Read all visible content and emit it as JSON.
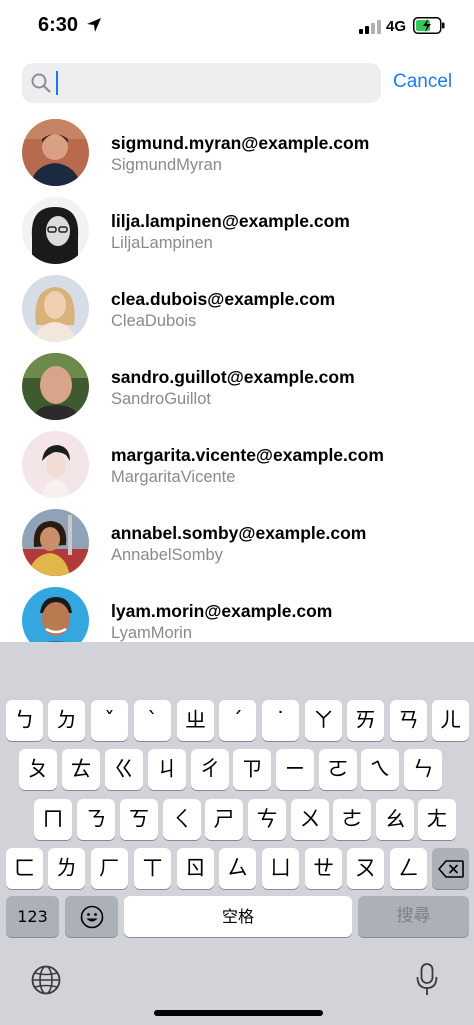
{
  "status_bar": {
    "time": "6:30",
    "network": "4G",
    "icons": [
      "location-arrow-icon",
      "signal-icon",
      "battery-charging-icon"
    ]
  },
  "search": {
    "value": "",
    "cancel_label": "Cancel",
    "icon": "search-icon"
  },
  "contacts": [
    {
      "email": "sigmund.myran@example.com",
      "username": "SigmundMyran"
    },
    {
      "email": "lilja.lampinen@example.com",
      "username": "LiljaLampinen"
    },
    {
      "email": "clea.dubois@example.com",
      "username": "CleaDubois"
    },
    {
      "email": "sandro.guillot@example.com",
      "username": "SandroGuillot"
    },
    {
      "email": "margarita.vicente@example.com",
      "username": "MargaritaVicente"
    },
    {
      "email": "annabel.somby@example.com",
      "username": "AnnabelSomby"
    },
    {
      "email": "lyam.morin@example.com",
      "username": "LyamMorin"
    }
  ],
  "keyboard": {
    "row1": [
      "ㄅ",
      "ㄉ",
      "ˇ",
      "ˋ",
      "ㄓ",
      "ˊ",
      "˙",
      "ㄚ",
      "ㄞ",
      "ㄢ",
      "ㄦ"
    ],
    "row2": [
      "ㄆ",
      "ㄊ",
      "ㄍ",
      "ㄐ",
      "ㄔ",
      "ㄗ",
      "ㄧ",
      "ㄛ",
      "ㄟ",
      "ㄣ"
    ],
    "row3": [
      "ㄇ",
      "ㄋ",
      "ㄎ",
      "ㄑ",
      "ㄕ",
      "ㄘ",
      "ㄨ",
      "ㄜ",
      "ㄠ",
      "ㄤ"
    ],
    "row4": [
      "ㄈ",
      "ㄌ",
      "ㄏ",
      "ㄒ",
      "ㄖ",
      "ㄙ",
      "ㄩ",
      "ㄝ",
      "ㄡ",
      "ㄥ"
    ],
    "numbers_label": "123",
    "space_label": "空格",
    "search_label": "搜尋",
    "icons": [
      "emoji-icon",
      "backspace-icon",
      "globe-icon",
      "microphone-icon"
    ]
  }
}
